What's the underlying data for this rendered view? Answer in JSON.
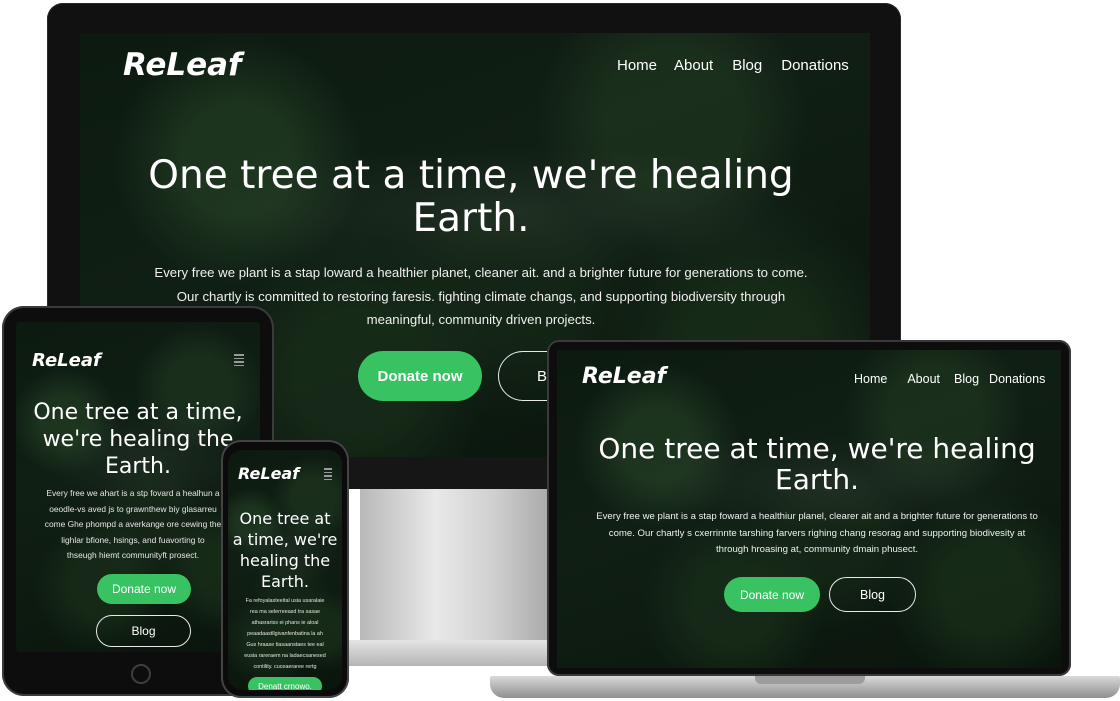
{
  "brand": "ReLeaf",
  "colors": {
    "accent": "#38c262",
    "background": "#0c1a10",
    "text": "#ffffff"
  },
  "desktop": {
    "nav": [
      "Home",
      "About",
      "Blog",
      "Donations"
    ],
    "title_line1": "One tree at a time, we're healing",
    "title_line2": "Earth.",
    "body_line1": "Every free we plant is a stap loward a healthier planet, cleaner ait. and a brighter future for generations to come.",
    "body_line2": "Our chartly is committed to restoring faresis. fighting climate changs, and supporting biodiversity through",
    "body_line3": "meaningful, community driven projects.",
    "donate_label": "Donate now",
    "blog_label": "Bl"
  },
  "laptop": {
    "nav": [
      "Home",
      "About",
      "Blog",
      "Donations"
    ],
    "title_line1": "One tree at time, we're healing",
    "title_line2": "Earth.",
    "body_line1": "Every free we plant is a stap foward a healthiur planel, clearer ait and a brighter future for generations to",
    "body_line2": "come. Our chartly s cxerrinnte tarshing farvers righing chang resorag and supporting biodivesity at",
    "body_line3": "through hroasing at, community dmain phusect.",
    "donate_label": "Donate now",
    "blog_label": "Blog"
  },
  "tablet": {
    "title_line1": "One tree at a time,",
    "title_line2": "we're healing the",
    "title_line3": "Earth.",
    "body_line1": "Every free we ahart is a stp fovard a healhun a",
    "body_line2": "oeodle-vs aved js to grawnthew biy glasarreu",
    "body_line3": "come Ghe phompd a averkange ore cewing the",
    "body_line4": "lighlar bfione, hsings, and fuavorting to",
    "body_line5": "thseugh hiemt communityft prosect.",
    "donate_label": "Donate now",
    "blog_label": "Blog"
  },
  "phone": {
    "title_line1": "One tree at",
    "title_line2": "a time, we're",
    "title_line3": "healing the",
    "title_line4": "Earth.",
    "body_line1": "Fa refoyalasteeital usia usaralaie",
    "body_line2": "rea ma selerreeasd tra sasae",
    "body_line3": "athasrariss ei phans ie aloal",
    "body_line4": "peaadaastllgivanfenbatina la ah",
    "body_line5": "Gus hraase tiasaanstaes tee eal",
    "body_line6": "eusia rareraem na ladaecsanesed",
    "body_line7": "contility. cuceaeraree rertg",
    "donate_label": "Denatt crnowo."
  }
}
